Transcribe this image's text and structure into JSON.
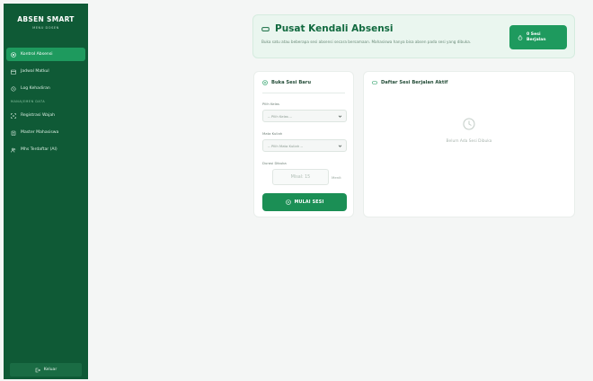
{
  "sidebar": {
    "brand_title": "ABSEN SMART",
    "brand_subtitle": "MENU DOSEN",
    "items": [
      {
        "label": "Kontrol Absensi",
        "icon": "target-icon",
        "active": true
      },
      {
        "label": "Jadwal Matkul",
        "icon": "calendar-icon",
        "active": false
      },
      {
        "label": "Log Kehadiran",
        "icon": "history-icon",
        "active": false
      }
    ],
    "section_label": "MANAJEMEN DATA",
    "section_items": [
      {
        "label": "Registrasi Wajah",
        "icon": "face-scan-icon"
      },
      {
        "label": "Master Mahasiswa",
        "icon": "clipboard-icon"
      },
      {
        "label": "Mhs Terdaftar (AI)",
        "icon": "users-icon"
      }
    ],
    "logout_label": "Keluar"
  },
  "banner": {
    "title": "Pusat Kendali Absensi",
    "description": "Buka satu atau beberapa sesi absensi secara bersamaan. Mahasiswa hanya bisa absen pada sesi yang dibuka.",
    "badge_line1": "0 Sesi",
    "badge_line2": "Berjalan"
  },
  "new_session": {
    "title": "Buka Sesi Baru",
    "class_label": "Pilih Kelas",
    "class_value": "-- Pilih Kelas --",
    "course_label": "Mata Kuliah",
    "course_value": "-- Pilih Mata Kuliah --",
    "duration_label": "Durasi Dibuka",
    "duration_placeholder": "Misal: 15",
    "duration_unit": "Menit",
    "start_button": "MULAI SESI"
  },
  "active_sessions": {
    "title": "Daftar Sesi Berjalan Aktif",
    "empty_text": "Belum Ada Sesi Dibuka"
  },
  "colors": {
    "sidebar_bg": "#0f5a36",
    "accent": "#1e9a5e",
    "banner_bg": "#eaf6ef"
  }
}
